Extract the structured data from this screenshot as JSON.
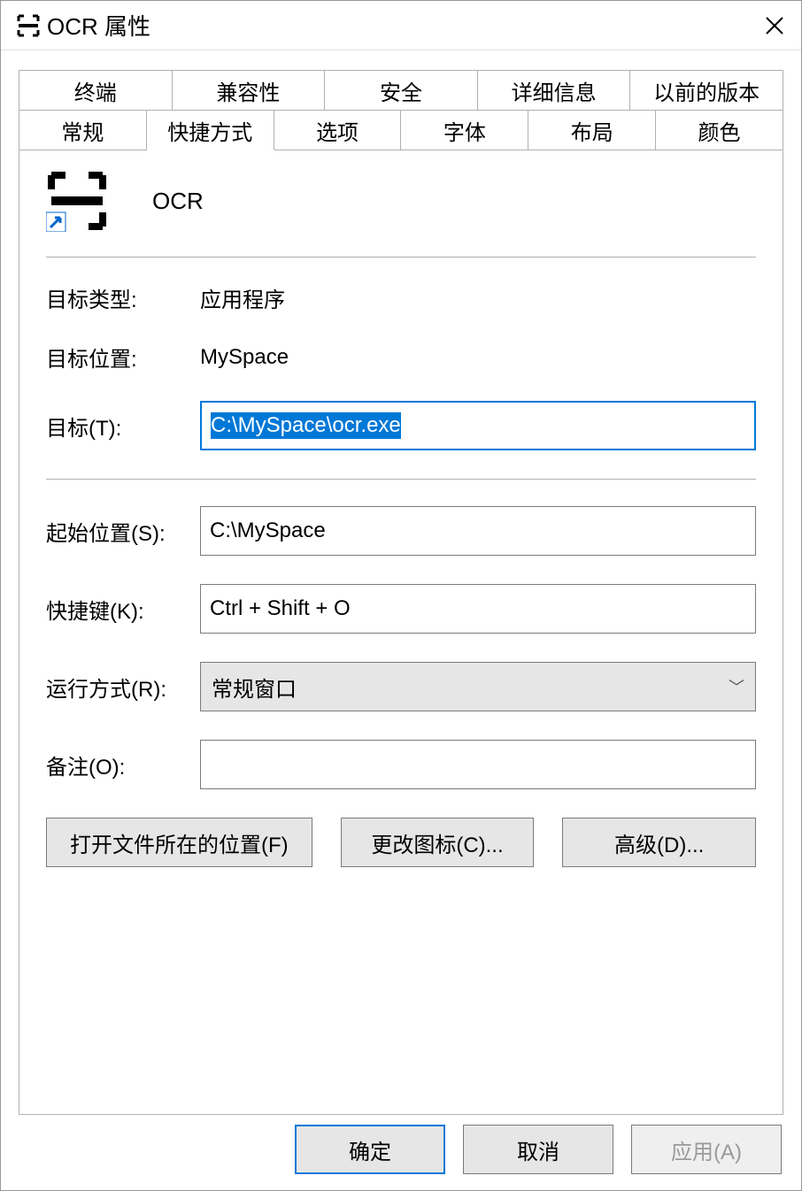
{
  "window": {
    "title": "OCR 属性"
  },
  "tabs_top": [
    "终端",
    "兼容性",
    "安全",
    "详细信息",
    "以前的版本"
  ],
  "tabs_bottom": [
    "常规",
    "快捷方式",
    "选项",
    "字体",
    "布局",
    "颜色"
  ],
  "active_tab": "快捷方式",
  "app_name": "OCR",
  "fields": {
    "target_type_label": "目标类型:",
    "target_type_value": "应用程序",
    "target_loc_label": "目标位置:",
    "target_loc_value": "MySpace",
    "target_label": "目标(T):",
    "target_value": "C:\\MySpace\\ocr.exe",
    "start_in_label": "起始位置(S):",
    "start_in_value": "C:\\MySpace",
    "shortcut_label": "快捷键(K):",
    "shortcut_value": "Ctrl + Shift + O",
    "run_label": "运行方式(R):",
    "run_value": "常规窗口",
    "comment_label": "备注(O):",
    "comment_value": ""
  },
  "buttons": {
    "open_location": "打开文件所在的位置(F)",
    "change_icon": "更改图标(C)...",
    "advanced": "高级(D)...",
    "ok": "确定",
    "cancel": "取消",
    "apply": "应用(A)"
  }
}
